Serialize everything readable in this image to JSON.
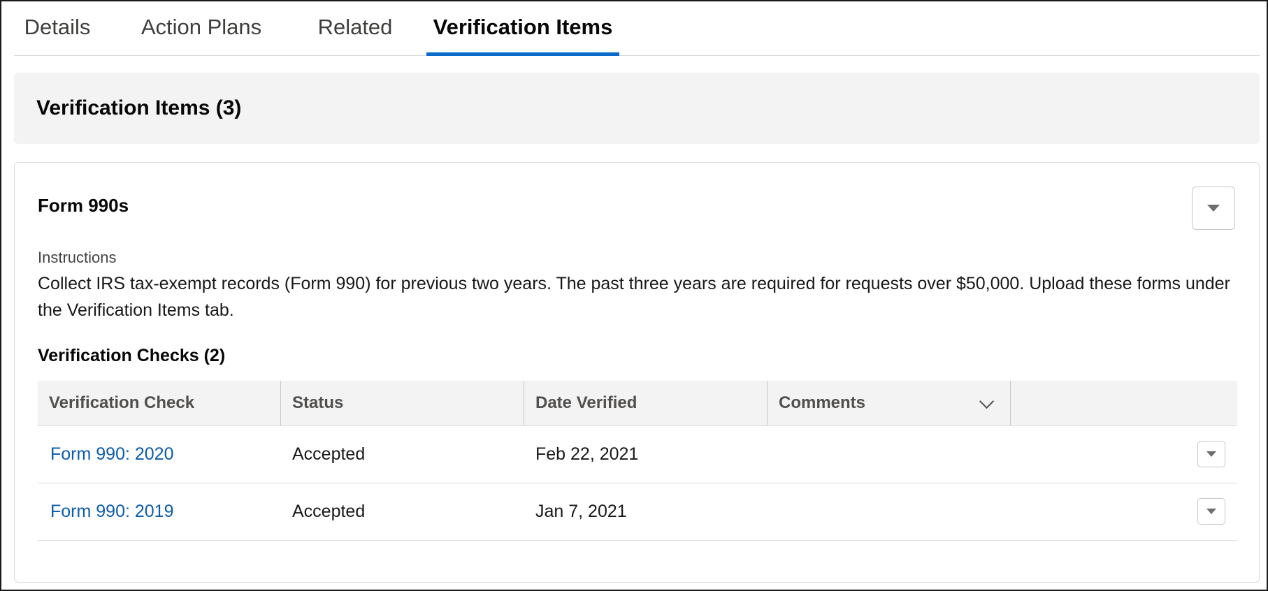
{
  "tabs": [
    {
      "label": "Details",
      "active": false
    },
    {
      "label": "Action Plans",
      "active": false
    },
    {
      "label": "Related",
      "active": false
    },
    {
      "label": "Verification Items",
      "active": true
    }
  ],
  "section": {
    "title": "Verification Items (3)"
  },
  "item": {
    "title": "Form 990s",
    "instructions_label": "Instructions",
    "instructions_text": "Collect IRS tax-exempt records (Form 990) for previous two years. The past three years are required for requests over $50,000. Upload these forms under the Verification Items tab.",
    "checks_title": "Verification Checks (2)",
    "table": {
      "columns": [
        "Verification Check",
        "Status",
        "Date Verified",
        "Comments"
      ],
      "rows": [
        {
          "check": "Form 990: 2020",
          "status": "Accepted",
          "date": "Feb 22, 2021",
          "comments": ""
        },
        {
          "check": "Form 990: 2019",
          "status": "Accepted",
          "date": "Jan 7, 2021",
          "comments": ""
        }
      ]
    }
  },
  "colors": {
    "accent": "#0b6bcb",
    "link": "#0b5cab",
    "header_bg": "#f3f3f3"
  },
  "icons": {
    "item_menu": "chevron-down-icon",
    "row_menu": "chevron-down-icon",
    "column_sort": "chevron-down-icon"
  }
}
